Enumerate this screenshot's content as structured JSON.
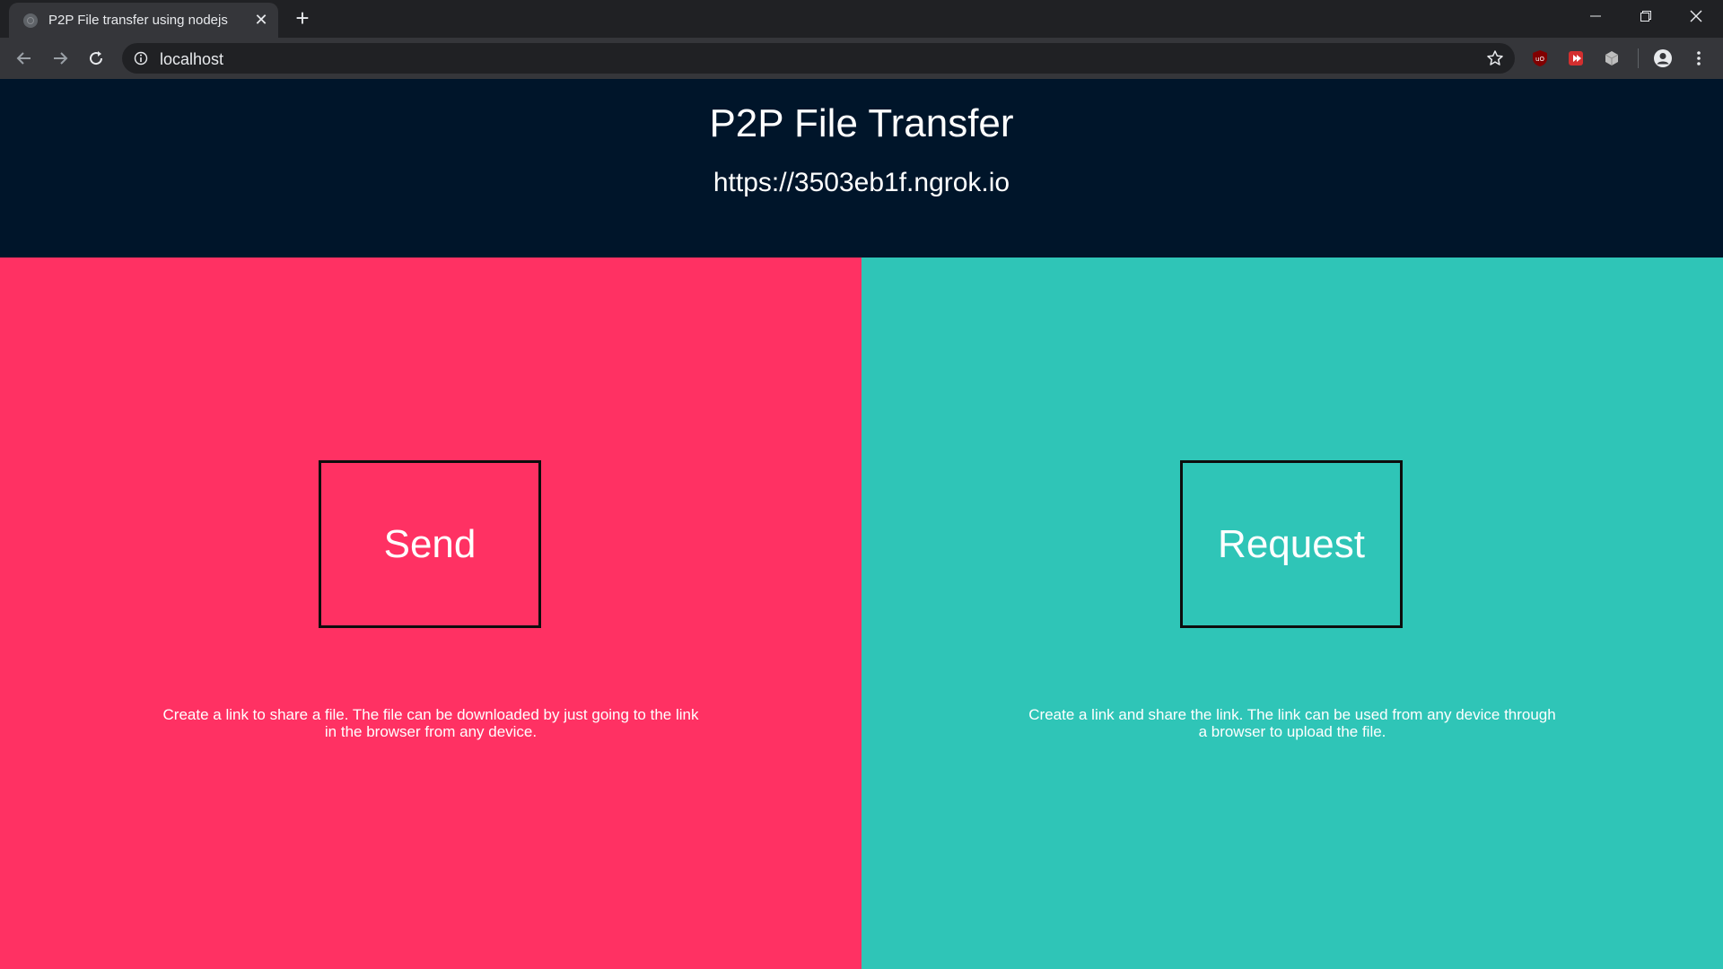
{
  "browser": {
    "tab_title": "P2P File transfer using nodejs",
    "url": "localhost",
    "colors": {
      "chrome_dark": "#202124",
      "chrome_light": "#35363a"
    }
  },
  "header": {
    "title": "P2P File Transfer",
    "url": "https://3503eb1f.ngrok.io"
  },
  "send": {
    "label": "Send",
    "description": "Create a link to share a file. The file can be downloaded by just going to the link in the browser from any device.",
    "color": "#ff3163"
  },
  "request": {
    "label": "Request",
    "description": "Create a link and share the link. The link can be used from any device through a browser to upload the file.",
    "color": "#2fc5b7"
  },
  "colors": {
    "header_bg": "#00152a"
  }
}
